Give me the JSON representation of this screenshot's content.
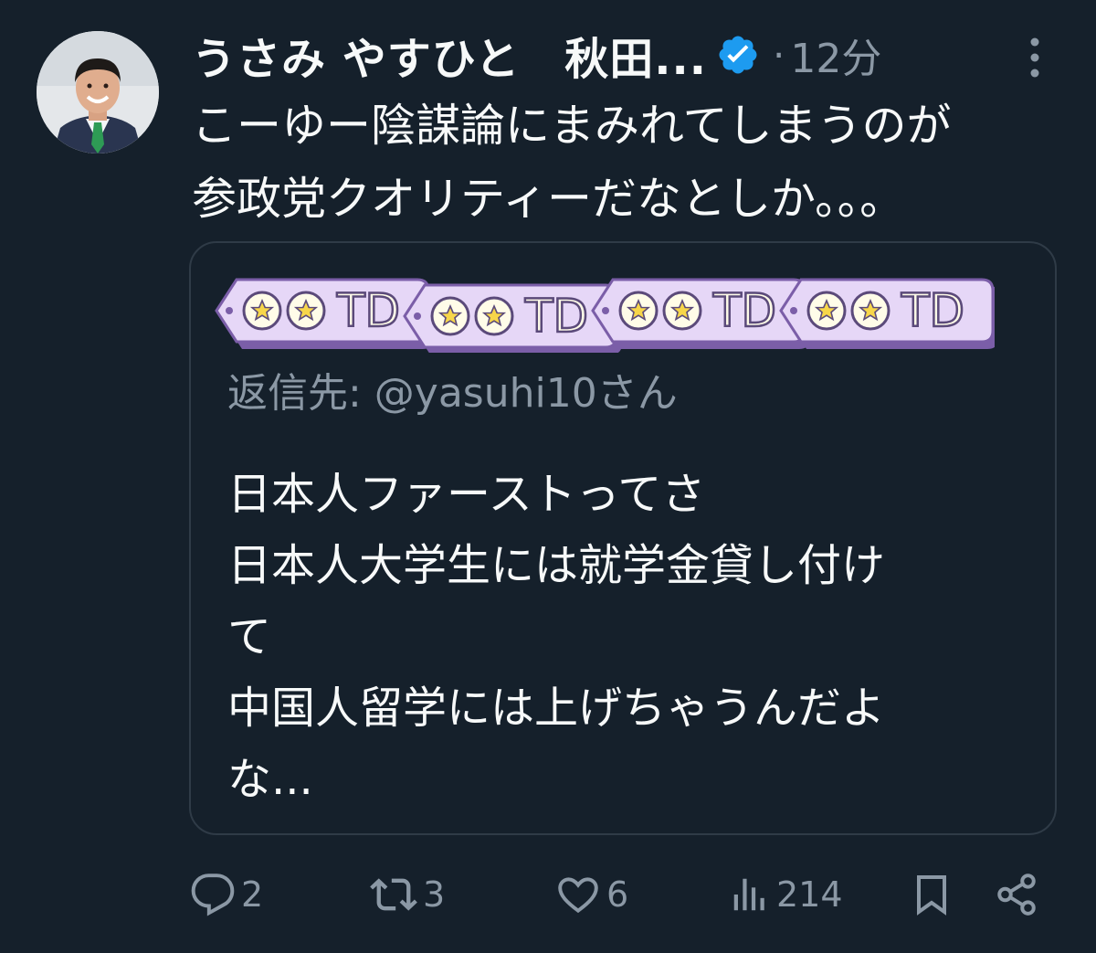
{
  "tweet": {
    "author_name": "うさみ やすひと　秋田...",
    "verified": true,
    "dot": "·",
    "timestamp": "12分",
    "text": "こーゆー陰謀論にまみれてしまうのが\n参政党クオリティーだなとしか。。。"
  },
  "quote": {
    "tag_text": "TD",
    "reply_to": "返信先: @yasuhi10さん",
    "text": "日本人ファーストってさ\n日本人大学生には就学金貸し付け\nて\n中国人留学には上げちゃうんだよ\nな..."
  },
  "actions": {
    "reply_count": "2",
    "retweet_count": "3",
    "like_count": "6",
    "views_count": "214"
  },
  "colors": {
    "background": "#15202b",
    "text_primary": "#f7f9f9",
    "text_secondary": "#8b98a5",
    "verified_blue": "#1d9bf0",
    "tag_purple": "#e6d7f7",
    "tag_border": "#7b5ea8"
  },
  "icons": [
    "verified-badge-icon",
    "more-icon",
    "reply-icon",
    "retweet-icon",
    "like-icon",
    "views-icon",
    "bookmark-icon",
    "share-icon",
    "star-icon"
  ]
}
